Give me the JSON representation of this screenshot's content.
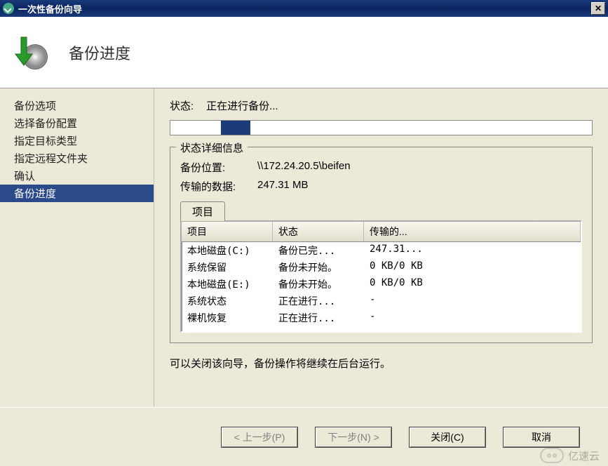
{
  "window": {
    "title": "一次性备份向导",
    "close": "✕"
  },
  "header": {
    "title": "备份进度"
  },
  "sidebar": {
    "items": [
      {
        "label": "备份选项",
        "active": false
      },
      {
        "label": "选择备份配置",
        "active": false
      },
      {
        "label": "指定目标类型",
        "active": false
      },
      {
        "label": "指定远程文件夹",
        "active": false
      },
      {
        "label": "确认",
        "active": false
      },
      {
        "label": "备份进度",
        "active": true
      }
    ]
  },
  "main": {
    "status_label": "状态:",
    "status_value": "正在进行备份...",
    "details_legend": "状态详细信息",
    "backup_location_label": "备份位置:",
    "backup_location_value": "\\\\172.24.20.5\\beifen",
    "transferred_label": "传输的数据:",
    "transferred_value": "247.31 MB",
    "tab_label": "项目",
    "columns": {
      "item": "项目",
      "status": "状态",
      "transferred": "传输的..."
    },
    "rows": [
      {
        "item": "本地磁盘(C:)",
        "status": "备份已完...",
        "transferred": "247.31..."
      },
      {
        "item": "系统保留",
        "status": "备份未开始。",
        "transferred": "0 KB/0 KB"
      },
      {
        "item": "本地磁盘(E:)",
        "status": "备份未开始。",
        "transferred": "0 KB/0 KB"
      },
      {
        "item": "系统状态",
        "status": "正在进行...",
        "transferred": "-"
      },
      {
        "item": "裸机恢复",
        "status": "正在进行...",
        "transferred": "-"
      }
    ],
    "hint": "可以关闭该向导，备份操作将继续在后台运行。"
  },
  "footer": {
    "prev": "< 上一步(P)",
    "next": "下一步(N) >",
    "close": "关闭(C)",
    "cancel": "取消"
  },
  "watermark": "亿速云"
}
